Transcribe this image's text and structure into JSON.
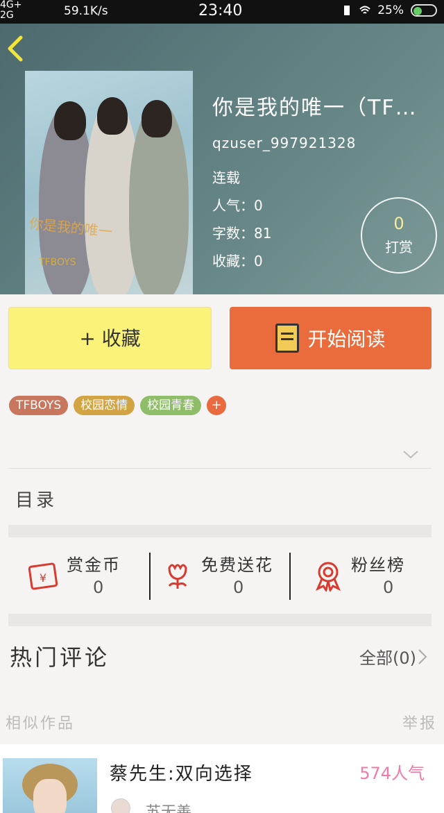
{
  "status_bar": {
    "network_top": "4G+",
    "network_bottom": "2G",
    "speed": "59.1K/s",
    "time": "23:40",
    "battery": "25%"
  },
  "book": {
    "title": "你是我的唯一（TF…",
    "author": "qzuser_997921328",
    "status": "连载",
    "popularity": "人气：0",
    "word_count": "字数：81",
    "favorites": "收藏：0",
    "cover_text_1": "你是我的唯一",
    "cover_text_2": "TFBOYS"
  },
  "tip": {
    "count": "0",
    "label": "打赏"
  },
  "buttons": {
    "favorite": "+ 收藏",
    "read": "开始阅读"
  },
  "tags": [
    {
      "label": "TFBOYS",
      "color": "#c8765e"
    },
    {
      "label": "校园恋情",
      "color": "#d3a443"
    },
    {
      "label": "校园青春",
      "color": "#8fbd6a"
    }
  ],
  "tag_add": "+",
  "toc_label": "目录",
  "stats": {
    "gold": {
      "label": "赏金币",
      "value": "0"
    },
    "flowers": {
      "label": "免费送花",
      "value": "0"
    },
    "fans": {
      "label": "粉丝榜",
      "value": "0"
    }
  },
  "comments": {
    "title": "热门评论",
    "all": "全部(0)"
  },
  "similar": {
    "title": "相似作品",
    "report": "举报"
  },
  "recommendation": {
    "title": "蔡先生:双向选择",
    "popularity": "574人气",
    "author": "苏无善"
  },
  "colors": {
    "accent_orange": "#ea6b3b",
    "accent_yellow": "#fbf279",
    "icon_red": "#d93a2f"
  }
}
